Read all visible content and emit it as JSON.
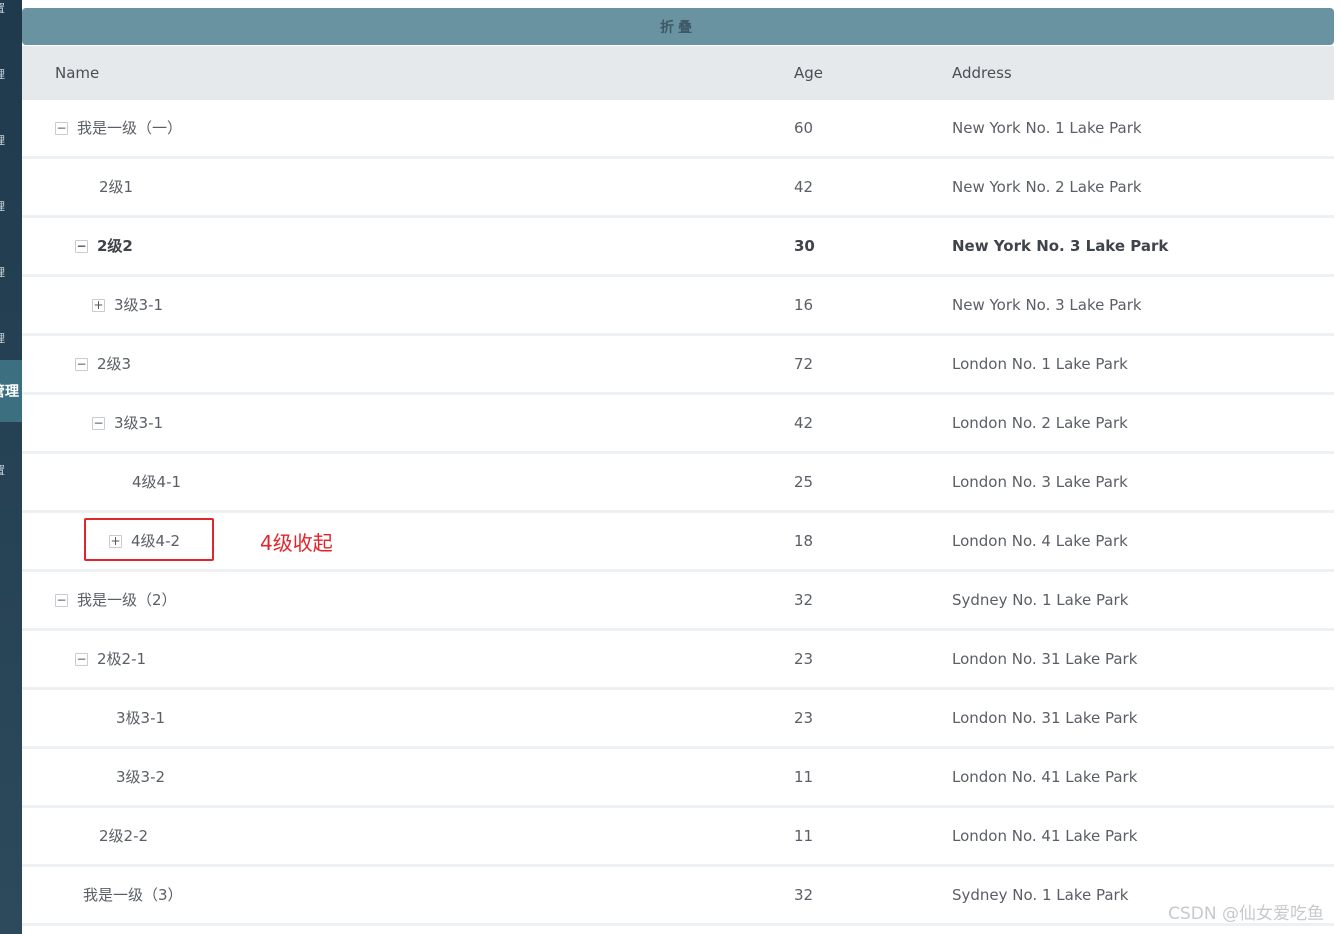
{
  "sidebar": {
    "items": [
      {
        "label": "置"
      },
      {
        "label": "理"
      },
      {
        "label": "理"
      },
      {
        "label": "理"
      },
      {
        "label": "理"
      },
      {
        "label": "理"
      },
      {
        "label": "置"
      }
    ],
    "active_label": "管理"
  },
  "collapse_label": "折叠",
  "table": {
    "headers": {
      "name": "Name",
      "age": "Age",
      "address": "Address"
    },
    "rows": [
      {
        "name": "我是一级（一）",
        "age": "60",
        "address": "New York No. 1 Lake Park",
        "toggle": "−"
      },
      {
        "name": "2级1",
        "age": "42",
        "address": "New York No. 2 Lake Park",
        "toggle": ""
      },
      {
        "name": "2级2",
        "age": "30",
        "address": "New York No. 3 Lake Park",
        "toggle": "−"
      },
      {
        "name": "3级3-1",
        "age": "16",
        "address": "New York No. 3 Lake Park",
        "toggle": "+"
      },
      {
        "name": "2级3",
        "age": "72",
        "address": "London No. 1 Lake Park",
        "toggle": "−"
      },
      {
        "name": "3级3-1",
        "age": "42",
        "address": "London No. 2 Lake Park",
        "toggle": "−"
      },
      {
        "name": "4级4-1",
        "age": "25",
        "address": "London No. 3 Lake Park",
        "toggle": ""
      },
      {
        "name": "4级4-2",
        "age": "18",
        "address": "London No. 4 Lake Park",
        "toggle": "+"
      },
      {
        "name": "我是一级（2）",
        "age": "32",
        "address": "Sydney No. 1 Lake Park",
        "toggle": "−"
      },
      {
        "name": "2极2-1",
        "age": "23",
        "address": "London No. 31 Lake Park",
        "toggle": "−"
      },
      {
        "name": "3极3-1",
        "age": "23",
        "address": "London No. 31 Lake Park",
        "toggle": ""
      },
      {
        "name": "3级3-2",
        "age": "11",
        "address": "London No. 41 Lake Park",
        "toggle": ""
      },
      {
        "name": "2级2-2",
        "age": "11",
        "address": "London No. 41 Lake Park",
        "toggle": ""
      },
      {
        "name": "我是一级（3）",
        "age": "32",
        "address": "Sydney No. 1 Lake Park",
        "toggle": ""
      }
    ]
  },
  "annotation": "4级收起",
  "watermark": "CSDN @仙女爱吃鱼",
  "colors": {
    "sidebar": "#2c4a5c",
    "collapse_bar": "#6993a0",
    "header_bg": "#e6e9ec",
    "annotation": "#e0262b"
  }
}
